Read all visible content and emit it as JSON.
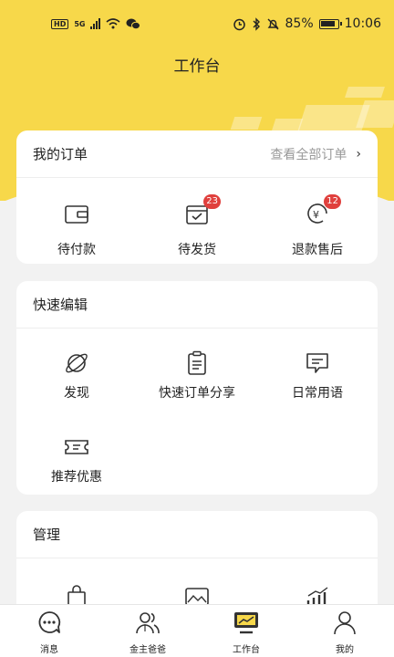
{
  "status_bar": {
    "network": "HD",
    "signal_label": "5G",
    "battery": "85%",
    "time": "10:06"
  },
  "header": {
    "title": "工作台"
  },
  "orders": {
    "title": "我的订单",
    "view_all": "查看全部订单",
    "items": [
      {
        "label": "待付款",
        "icon": "wallet-icon",
        "badge": ""
      },
      {
        "label": "待发货",
        "icon": "calendar-check-icon",
        "badge": "23"
      },
      {
        "label": "退款售后",
        "icon": "refund-icon",
        "badge": "12"
      }
    ]
  },
  "quick_edit": {
    "title": "快速编辑",
    "items": [
      {
        "label": "发现",
        "icon": "planet-icon"
      },
      {
        "label": "快速订单分享",
        "icon": "clipboard-icon"
      },
      {
        "label": "日常用语",
        "icon": "message-icon"
      },
      {
        "label": "推荐优惠",
        "icon": "coupon-icon"
      }
    ]
  },
  "manage": {
    "title": "管理"
  },
  "tabbar": {
    "items": [
      {
        "label": "消息",
        "icon": "chat-icon"
      },
      {
        "label": "金主爸爸",
        "icon": "users-icon"
      },
      {
        "label": "工作台",
        "icon": "monitor-icon"
      },
      {
        "label": "我的",
        "icon": "person-icon"
      }
    ]
  },
  "colors": {
    "accent": "#f7d84a",
    "badge": "#e0403d",
    "background": "#f2f2f2"
  }
}
